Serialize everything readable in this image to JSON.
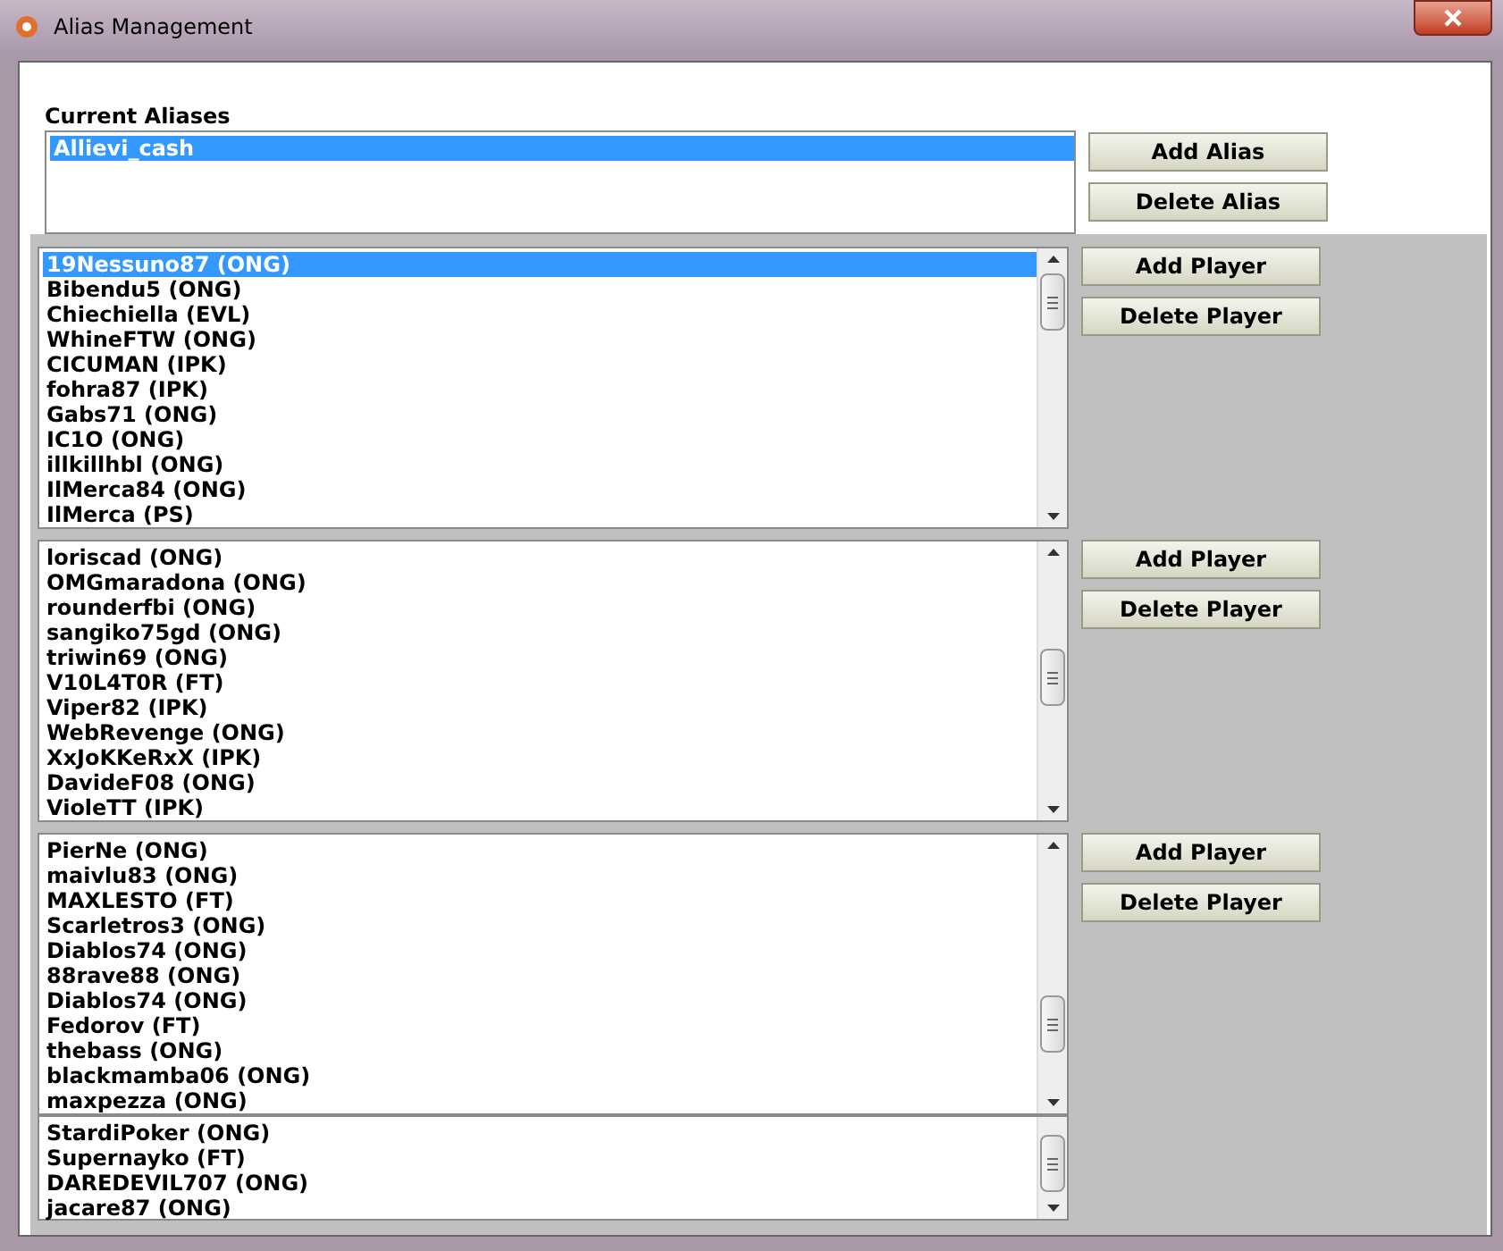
{
  "window": {
    "title": "Alias Management"
  },
  "aliases": {
    "label": "Current Aliases",
    "items": [
      {
        "text": "Allievi_cash",
        "selected": true
      }
    ],
    "buttons": [
      "Add Alias",
      "Delete Alias"
    ]
  },
  "player_lists": [
    {
      "items": [
        {
          "text": "19Nessuno87 (ONG)",
          "selected": true
        },
        {
          "text": "Bibendu5 (ONG)",
          "selected": false
        },
        {
          "text": "Chiechiella (EVL)",
          "selected": false
        },
        {
          "text": "WhineFTW (ONG)",
          "selected": false
        },
        {
          "text": "CICUMAN (IPK)",
          "selected": false
        },
        {
          "text": "fohra87 (IPK)",
          "selected": false
        },
        {
          "text": "Gabs71 (ONG)",
          "selected": false
        },
        {
          "text": "IC1O (ONG)",
          "selected": false
        },
        {
          "text": "illkillhbl (ONG)",
          "selected": false
        },
        {
          "text": "IlMerca84 (ONG)",
          "selected": false
        },
        {
          "text": "IlMerca (PS)",
          "selected": false
        }
      ],
      "buttons": [
        "Add Player",
        "Delete Player"
      ]
    },
    {
      "items": [
        {
          "text": "loriscad (ONG)",
          "selected": false
        },
        {
          "text": "OMGmaradona (ONG)",
          "selected": false
        },
        {
          "text": "rounderfbi (ONG)",
          "selected": false
        },
        {
          "text": "sangiko75gd (ONG)",
          "selected": false
        },
        {
          "text": "triwin69 (ONG)",
          "selected": false
        },
        {
          "text": "V10L4T0R (FT)",
          "selected": false
        },
        {
          "text": "Viper82 (IPK)",
          "selected": false
        },
        {
          "text": "WebRevenge (ONG)",
          "selected": false
        },
        {
          "text": "XxJoKKeRxX (IPK)",
          "selected": false
        },
        {
          "text": "DavideF08 (ONG)",
          "selected": false
        },
        {
          "text": "VioleTT (IPK)",
          "selected": false
        }
      ],
      "buttons": [
        "Add Player",
        "Delete Player"
      ]
    },
    {
      "items": [
        {
          "text": "PierNe (ONG)",
          "selected": false
        },
        {
          "text": "maivlu83 (ONG)",
          "selected": false
        },
        {
          "text": "MAXLESTO (FT)",
          "selected": false
        },
        {
          "text": "Scarletros3 (ONG)",
          "selected": false
        },
        {
          "text": "Diablos74 (ONG)",
          "selected": false
        },
        {
          "text": "88rave88 (ONG)",
          "selected": false
        },
        {
          "text": "Diablos74 (ONG)",
          "selected": false
        },
        {
          "text": "Fedorov (FT)",
          "selected": false
        },
        {
          "text": "thebass (ONG)",
          "selected": false
        },
        {
          "text": "blackmamba06 (ONG)",
          "selected": false
        },
        {
          "text": "maxpezza (ONG)",
          "selected": false
        }
      ],
      "buttons": [
        "Add Player",
        "Delete Player"
      ]
    },
    {
      "items": [
        {
          "text": "StardiPoker (ONG)",
          "selected": false
        },
        {
          "text": "Supernayko (FT)",
          "selected": false
        },
        {
          "text": "DAREDEVIL707 (ONG)",
          "selected": false
        },
        {
          "text": "jacare87 (ONG)",
          "selected": false
        }
      ]
    }
  ]
}
